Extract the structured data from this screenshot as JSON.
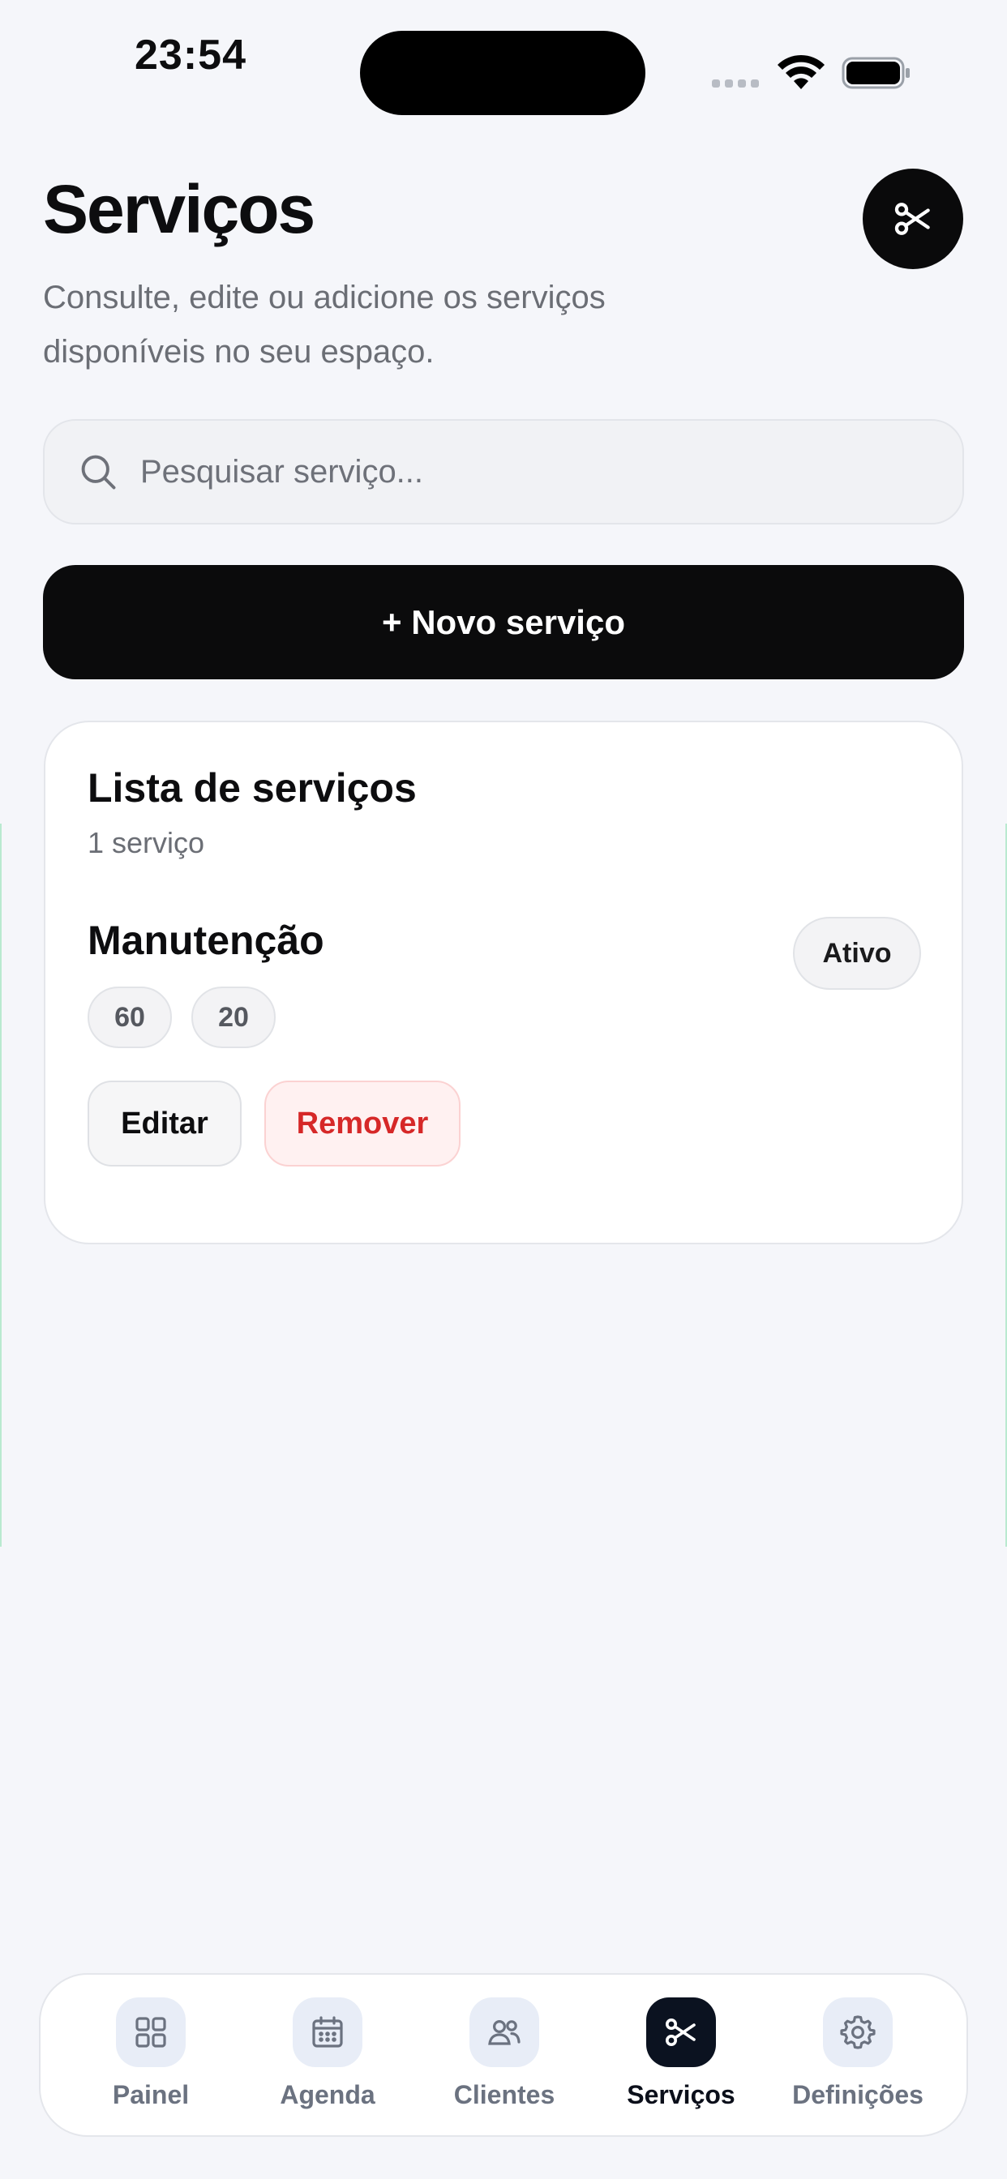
{
  "status_bar": {
    "time": "23:54"
  },
  "header": {
    "title": "Serviços",
    "subtitle": "Consulte, edite ou adicione os serviços disponíveis no seu espaço.",
    "action_icon": "scissors-icon"
  },
  "search": {
    "placeholder": "Pesquisar serviço...",
    "value": ""
  },
  "new_button": {
    "label": "+ Novo serviço"
  },
  "services_card": {
    "title": "Lista de serviços",
    "count_label": "1 serviço",
    "items": [
      {
        "name": "Manutenção",
        "status": "Ativo",
        "chips": [
          "60",
          "20"
        ],
        "edit_label": "Editar",
        "remove_label": "Remover"
      }
    ]
  },
  "tabbar": {
    "active": "Serviços",
    "items": [
      {
        "label": "Painel",
        "icon": "grid-icon"
      },
      {
        "label": "Agenda",
        "icon": "calendar-icon"
      },
      {
        "label": "Clientes",
        "icon": "users-icon"
      },
      {
        "label": "Serviços",
        "icon": "scissors-icon"
      },
      {
        "label": "Definições",
        "icon": "gear-icon"
      }
    ]
  },
  "colors": {
    "background": "#f5f6fa",
    "primary": "#0b0b0c",
    "danger": "#d62828",
    "muted_text": "#6b6e75"
  }
}
